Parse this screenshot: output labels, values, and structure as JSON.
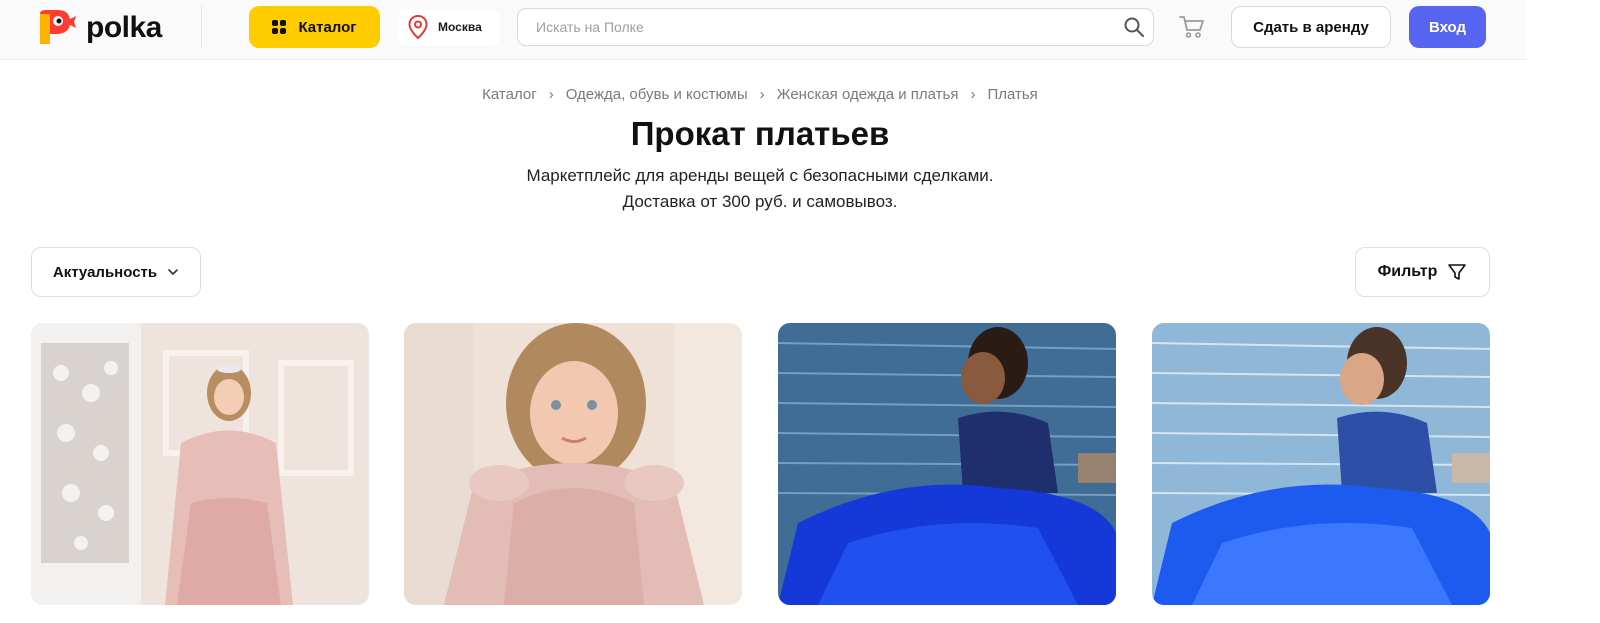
{
  "header": {
    "logo_text": "polka",
    "catalog_label": "Каталог",
    "city": "Москва",
    "search_placeholder": "Искать на Полке",
    "rent_label": "Сдать в аренду",
    "login_label": "Вход",
    "colors": {
      "catalog_bg": "#ffcc00",
      "login_bg": "#5865f2",
      "logo_red": "#ff3b30",
      "logo_yellow": "#ffb300"
    }
  },
  "breadcrumb": {
    "items": [
      "Каталог",
      "Одежда, обувь и костюмы",
      "Женская одежда и платья",
      "Платья"
    ],
    "separator": "›"
  },
  "page": {
    "title": "Прокат платьев",
    "subtitle_line1": "Маркетплейс для аренды вещей с безопасными сделками.",
    "subtitle_line2": "Доставка от 300 руб. и самовывоз."
  },
  "controls": {
    "sort_label": "Актуальность",
    "filter_label": "Фильтр"
  },
  "products": [
    {
      "image": "girl-in-pink-dress-full-length"
    },
    {
      "image": "girl-in-pink-dress-closeup"
    },
    {
      "image": "girl-in-blue-dress-by-water"
    },
    {
      "image": "girl-in-blue-dress-by-water-bright"
    }
  ]
}
